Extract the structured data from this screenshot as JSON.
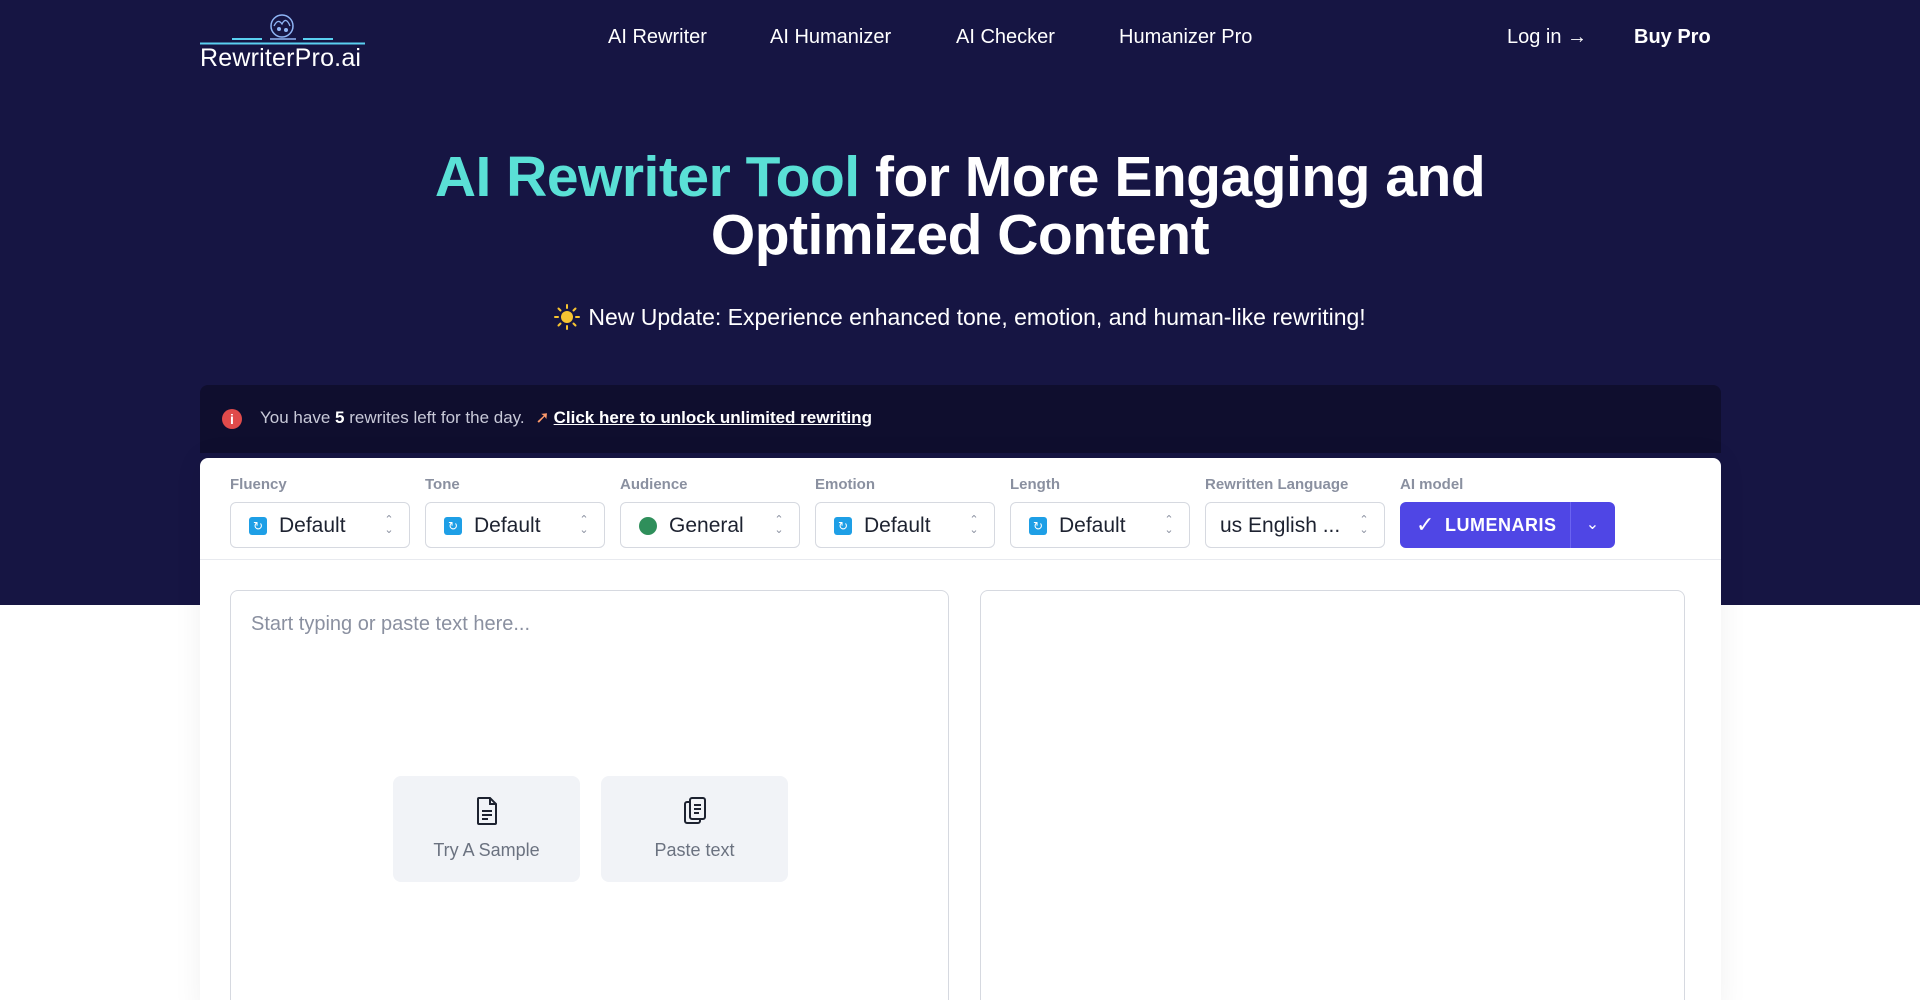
{
  "nav": {
    "logo_text": "RewriterPro.ai",
    "links": [
      "AI Rewriter",
      "AI Humanizer",
      "AI Checker",
      "Humanizer Pro"
    ],
    "login": "Log in →",
    "buy": "Buy Pro"
  },
  "hero": {
    "title_accent": "AI Rewriter Tool",
    "title_rest_line1": " for More Engaging and",
    "title_line2": "Optimized Content",
    "update": "New Update: Experience enhanced tone, emotion, and human-like rewriting!"
  },
  "notice": {
    "prefix": "You have",
    "count": "5",
    "suffix": "rewrites left for the day.",
    "link": "Click here to unlock unlimited rewriting"
  },
  "options": [
    {
      "label": "Fluency",
      "value": "Default"
    },
    {
      "label": "Tone",
      "value": "Default"
    },
    {
      "label": "Audience",
      "value": "General"
    },
    {
      "label": "Emotion",
      "value": "Default"
    },
    {
      "label": "Length",
      "value": "Default"
    },
    {
      "label": "Rewritten Language",
      "value": "us English ..."
    }
  ],
  "model": {
    "label": "AI model",
    "value": "LUMENARIS"
  },
  "editor": {
    "placeholder": "Start typing or paste text here...",
    "sample_button": "Try A Sample",
    "paste_button": "Paste text"
  },
  "colors": {
    "hero_bg": "#161543",
    "accent_text": "#5ae0d6",
    "primary_button": "#4f46e5"
  }
}
